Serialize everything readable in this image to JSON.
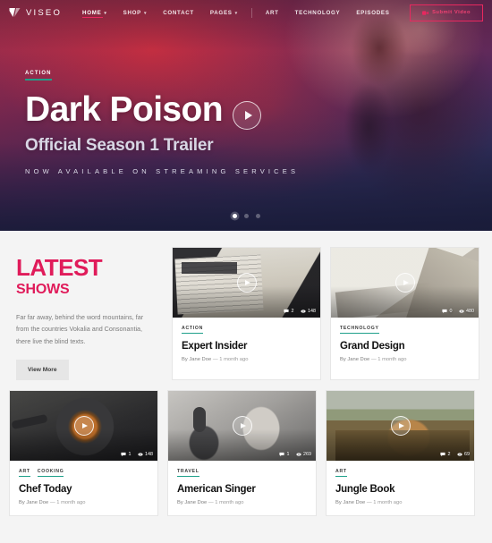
{
  "brand": {
    "name": "VISEO",
    "logo_icon": "chevron-flag-logo"
  },
  "nav": {
    "items": [
      {
        "label": "HOME",
        "has_dropdown": true,
        "active": true
      },
      {
        "label": "SHOP",
        "has_dropdown": true,
        "active": false
      },
      {
        "label": "CONTACT",
        "has_dropdown": false,
        "active": false
      },
      {
        "label": "PAGES",
        "has_dropdown": true,
        "active": false
      }
    ],
    "secondary_items": [
      {
        "label": "ART"
      },
      {
        "label": "TECHNOLOGY"
      },
      {
        "label": "EPISODES"
      }
    ],
    "submit_button": {
      "label": "Submit Video",
      "icon": "video-camera-icon",
      "accent": "#e8285f"
    }
  },
  "hero": {
    "badge": "ACTION",
    "title": "Dark Poison",
    "subtitle": "Official Season 1 Trailer",
    "tagline": "NOW AVAILABLE ON STREAMING SERVICES",
    "play_icon": "play-circle-icon",
    "slides": [
      {
        "active": true
      },
      {
        "active": false
      },
      {
        "active": false
      }
    ]
  },
  "latest": {
    "heading_line1": "LATEST",
    "heading_line2": "SHOWS",
    "description": "Far far away, behind the word mountains, far from the countries Vokalia and Consonantia, there live the blind texts.",
    "button_label": "View More",
    "accent": "#e01b5a"
  },
  "cards": [
    {
      "id": "expert-insider",
      "thumb": "thumb-biz",
      "categories": [
        "ACTION"
      ],
      "title": "Expert Insider",
      "author": "By Jane Doe",
      "date": "1 month ago",
      "comments": "2",
      "views": "148"
    },
    {
      "id": "grand-design",
      "thumb": "thumb-design",
      "categories": [
        "TECHNOLOGY"
      ],
      "title": "Grand Design",
      "author": "By Jane Doe",
      "date": "1 month ago",
      "comments": "0",
      "views": "480"
    },
    {
      "id": "chef-today",
      "thumb": "thumb-chef",
      "categories": [
        "ART",
        "COOKING"
      ],
      "title": "Chef Today",
      "author": "By Jane Doe",
      "date": "1 month ago",
      "comments": "1",
      "views": "148"
    },
    {
      "id": "american-singer",
      "thumb": "thumb-singer",
      "categories": [
        "TRAVEL"
      ],
      "title": "American Singer",
      "author": "By Jane Doe",
      "date": "1 month ago",
      "comments": "1",
      "views": "269"
    },
    {
      "id": "jungle-book",
      "thumb": "thumb-lion",
      "categories": [
        "ART"
      ],
      "title": "Jungle Book",
      "author": "By Jane Doe",
      "date": "1 month ago",
      "comments": "2",
      "views": "69"
    }
  ],
  "separator": "—"
}
